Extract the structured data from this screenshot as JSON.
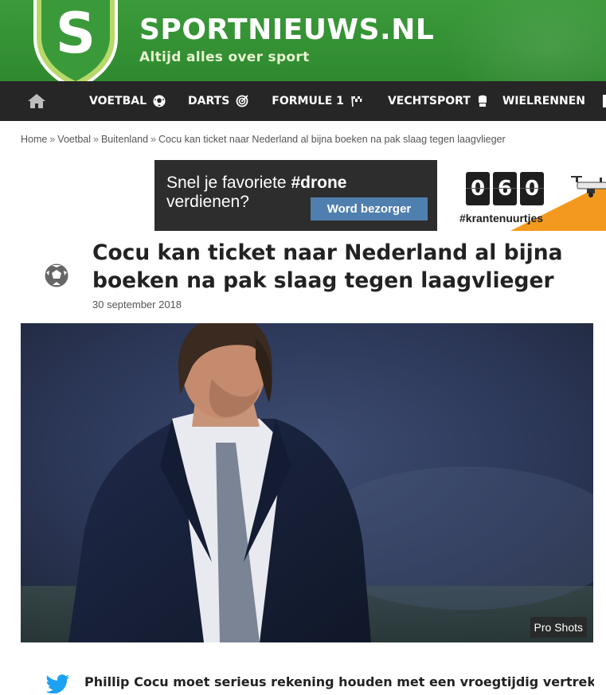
{
  "header": {
    "logo_letter": "S",
    "brand": "SPORTNIEUWS.NL",
    "tagline": "Altijd alles over sport"
  },
  "nav": {
    "items": [
      {
        "label": "VOETBAL",
        "icon": "soccer-ball-icon"
      },
      {
        "label": "DARTS",
        "icon": "dartboard-icon"
      },
      {
        "label": "FORMULE 1",
        "icon": "checkered-flag-icon"
      },
      {
        "label": "VECHTSPORT",
        "icon": "boxing-glove-icon"
      },
      {
        "label": "WIELRENNEN",
        "icon": ""
      }
    ]
  },
  "breadcrumb": {
    "items": [
      "Home",
      "Voetbal",
      "Buitenland"
    ],
    "current": "Cocu kan ticket naar Nederland al bijna boeken na pak slaag tegen laagvlieger",
    "separator": "»"
  },
  "ad": {
    "text_plain": "Snel je favoriete ",
    "text_bold": "#drone",
    "text_line2": "verdienen?",
    "button": "Word bezorger",
    "digits": [
      "0",
      "6",
      "0"
    ],
    "hashtag": "#krantenuurtjes"
  },
  "article": {
    "title": "Cocu kan ticket naar Nederland al bijna boeken na pak slaag tegen laagvlieger",
    "date": "30 september 2018",
    "photo_credit": "Pro Shots",
    "lead": "Phillip Cocu moet serieus rekening houden met een vroegtijdig vertrek bij"
  },
  "colors": {
    "header_green": "#2f8a2f",
    "nav_dark": "#262626",
    "ad_button": "#4f7fae",
    "ad_orange": "#f39a1e",
    "twitter_blue": "#1da1f2"
  }
}
